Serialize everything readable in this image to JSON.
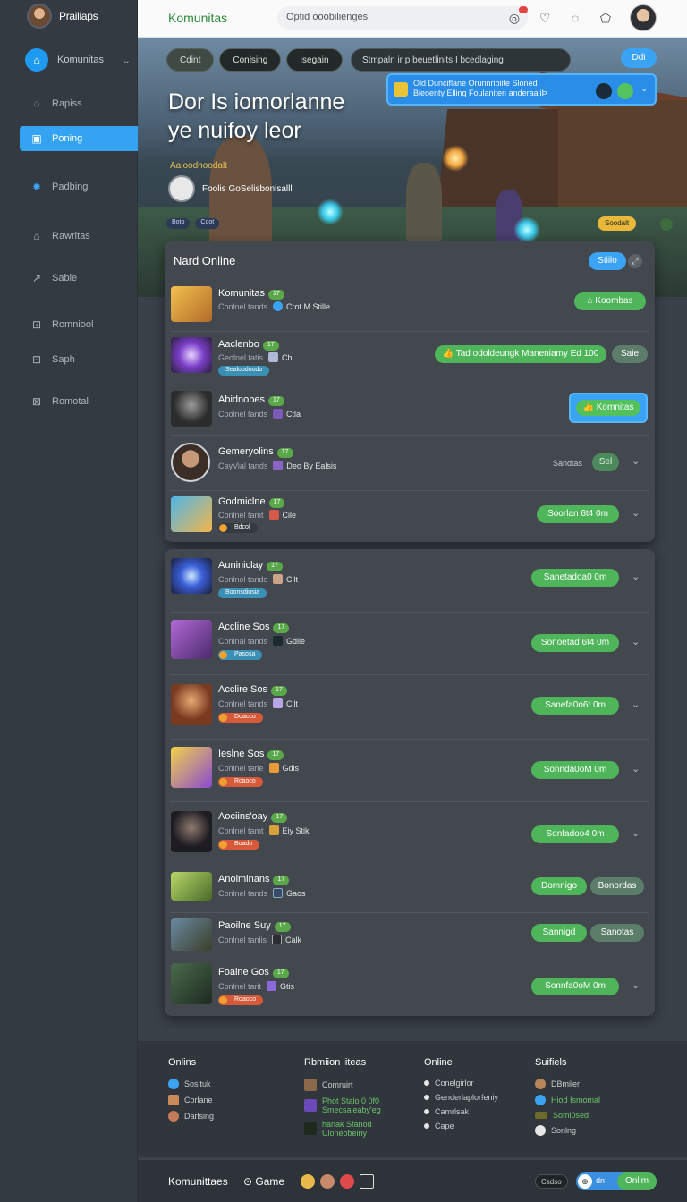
{
  "sidebar": {
    "profile_name": "Prailiaps",
    "selector_label": "Komunitas",
    "items": [
      {
        "label": "Rapiss",
        "icon": "circle-icon"
      },
      {
        "label": "Poning",
        "icon": "image-icon",
        "active": true
      },
      {
        "label": "Padbing",
        "icon": "gear-icon"
      },
      {
        "label": "Rawritas",
        "icon": "document-icon"
      },
      {
        "label": "Sabie",
        "icon": "arrow-icon"
      },
      {
        "label": "Romniool",
        "icon": "file-icon"
      },
      {
        "label": "Saph",
        "icon": "box-icon"
      },
      {
        "label": "Romotal",
        "icon": "close-box-icon"
      }
    ]
  },
  "topbar": {
    "brand": "Komunitas",
    "search_placeholder": "Optid ooobilienges"
  },
  "hero": {
    "tabs": [
      "Cdint",
      "Conlsing",
      "Isegain"
    ],
    "search_text": "Stmpaln ir p beuetlinits I bcedlaging",
    "action_label": "Ddi",
    "banner_line1": "Old Dunciflane Orunnribiite Sloned",
    "banner_line2": "Bieoenty Elling Foulaniten anderaaliÞ",
    "title": "Dor Is iomorlanne ye nuifoy leor",
    "subtitle": "Aaloodhoodalt",
    "user_text": "Foolis GoSelisbonlsalll",
    "chips": [
      "Boto",
      "Coot"
    ],
    "chip_right": "Soodalt"
  },
  "panel": {
    "title": "Nard Online",
    "button": "Stiilo"
  },
  "users": [
    {
      "name": "Komunitas",
      "sub": "Conlnel tands",
      "game": "Crot M Stille",
      "action": "Koombas",
      "type": "green"
    },
    {
      "name": "Aaclenbo",
      "sub": "Geolnel tatis",
      "game": "Chl",
      "tag": "Sealoodnodo",
      "action": "Tad odoldeungk Maneniamy Ed 100",
      "secondary": "Saie",
      "type": "wide"
    },
    {
      "name": "Abidnobes",
      "sub": "Coolnel tands",
      "game": "Ctla",
      "action": "Komnitas",
      "type": "chat"
    },
    {
      "name": "Gemeryolins",
      "sub": "CayVial tands",
      "game": "Deo By Ealsis",
      "action": "Sel",
      "label": "Sandtas",
      "type": "small"
    },
    {
      "name": "Godmiclne",
      "sub": "Conlnel tamt",
      "game": "Cile",
      "tag": "Bdcol",
      "action": "Soorlan 6t4 0m",
      "type": "green"
    },
    {
      "name": "Auniniclay",
      "sub": "Conlnel tands",
      "game": "Cilt",
      "tag": "Boonsdiusia",
      "action": "Sanetadoa0 0m",
      "type": "green"
    },
    {
      "name": "Accline Sos",
      "sub": "Conlnal tands",
      "game": "Gdlle",
      "tag": "Pasosa",
      "action": "Sonoetad 6t4 0m",
      "type": "green"
    },
    {
      "name": "Acclire Sos",
      "sub": "Conlnel tands",
      "game": "Cilt",
      "tag": "Doacco",
      "action": "Sanefa0o6t 0m",
      "type": "green"
    },
    {
      "name": "Ieslne Sos",
      "sub": "Conlnel tarie",
      "game": "Gdis",
      "tag": "Rcaoco",
      "action": "Sonnda0oM 0m",
      "type": "green"
    },
    {
      "name": "Aociins'oay",
      "sub": "Conlnel tamt",
      "game": "Eiy Stik",
      "tag": "Boado",
      "action": "Sonfadoo4 0m",
      "type": "green"
    },
    {
      "name": "Anoiminans",
      "sub": "Conlnel tands",
      "game": "Gaos",
      "action": "Domnigo",
      "secondary": "Bonordas",
      "type": "pair"
    },
    {
      "name": "Paoilne Suy",
      "sub": "Conlnel tanlis",
      "game": "Calk",
      "action": "Sannigd",
      "secondary": "Sanotas",
      "type": "pair"
    },
    {
      "name": "Foalne Gos",
      "sub": "Conlnel tarit",
      "game": "Gtis",
      "tag": "Roaoco",
      "action": "Sonnfa0oM 0m",
      "type": "green"
    }
  ],
  "footer": {
    "col1": {
      "title": "Onlins",
      "items": [
        "Sosituk",
        "Corlane",
        "Darlsing"
      ]
    },
    "col2": {
      "title": "Rbmiion iiteas",
      "items": [
        "Comruirt",
        "Phot Stalo 0 0f0 Smecsaleaby'eg",
        "hanak Sfanod Uloneobeiny"
      ]
    },
    "col3": {
      "title": "Online",
      "items": [
        "Conelgirlor",
        "Genderlaplorfeniy",
        "Camrlsak",
        "Cape"
      ]
    },
    "col4": {
      "title": "Suifiels",
      "items": [
        "DBmiler",
        "Hiod Ismomal",
        "Somi0sed",
        "Sonlng"
      ]
    }
  },
  "bottombar": {
    "brand": "Komunittaes",
    "game": "Game",
    "chip": "Csdso",
    "toggle_label": "dn",
    "online": "Onlim"
  }
}
